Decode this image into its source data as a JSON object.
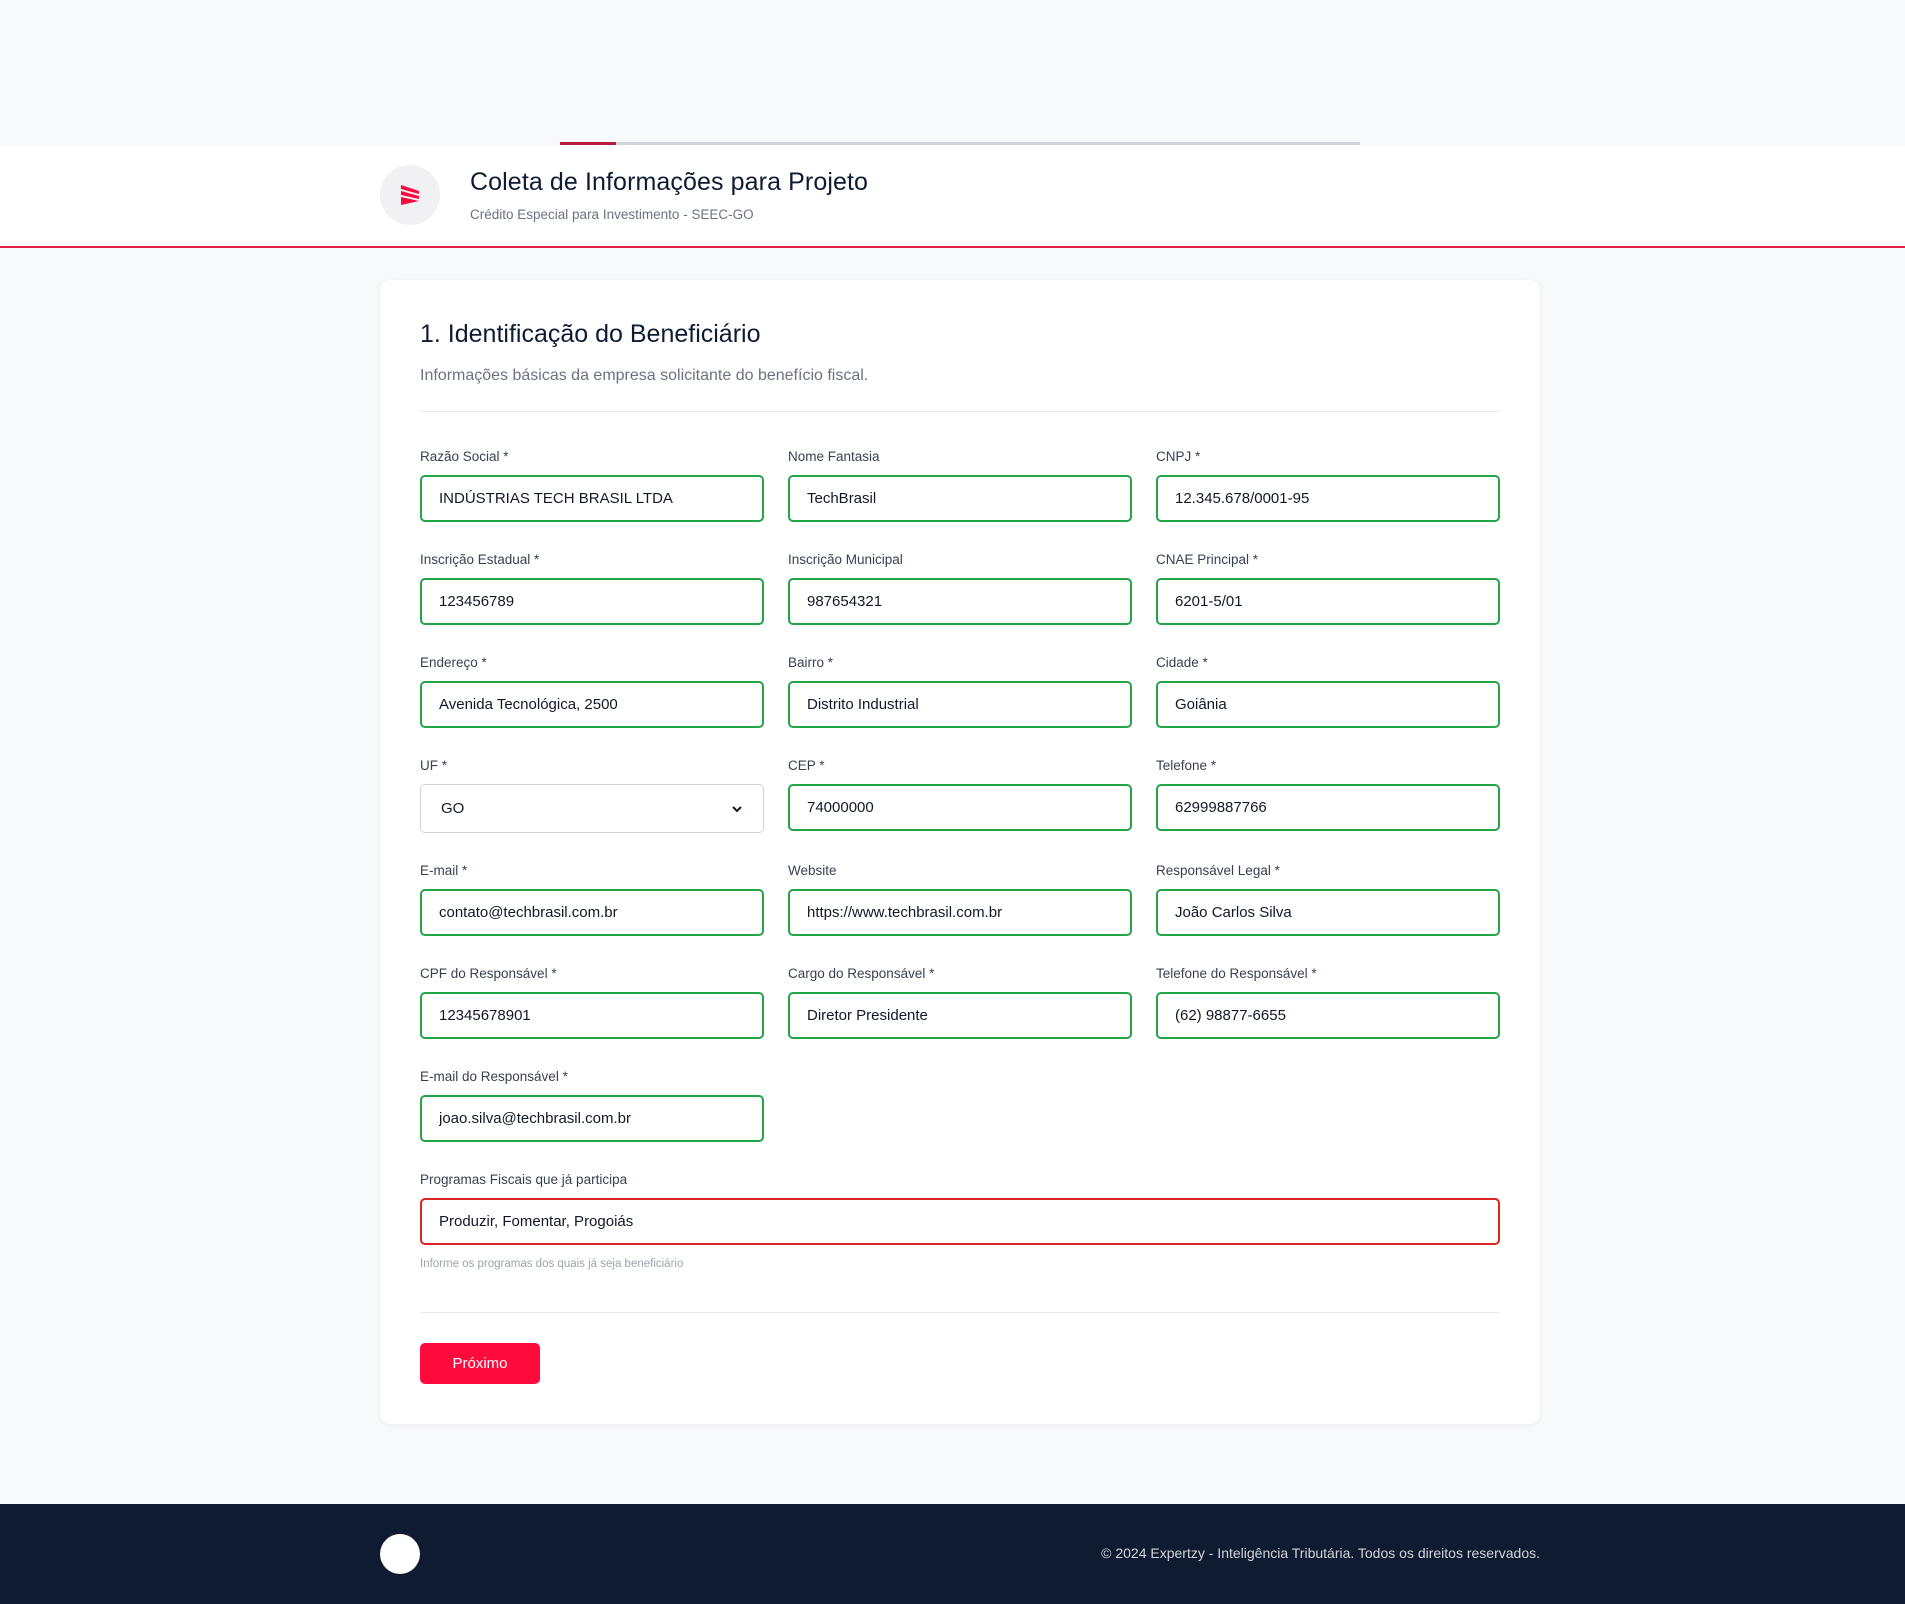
{
  "progress": {
    "percent": 7
  },
  "header": {
    "title": "Coleta de Informações para Projeto",
    "subtitle": "Crédito Especial para Investimento - SEEC-GO"
  },
  "section": {
    "title": "1. Identificação do Beneficiário",
    "description": "Informações básicas da empresa solicitante do benefício fiscal."
  },
  "fields": {
    "razao_social": {
      "label": "Razão Social *",
      "value": "INDÚSTRIAS TECH BRASIL LTDA"
    },
    "nome_fantasia": {
      "label": "Nome Fantasia",
      "value": "TechBrasil"
    },
    "cnpj": {
      "label": "CNPJ *",
      "value": "12.345.678/0001-95"
    },
    "inscricao_estadual": {
      "label": "Inscrição Estadual *",
      "value": "123456789"
    },
    "inscricao_municipal": {
      "label": "Inscrição Municipal",
      "value": "987654321"
    },
    "cnae": {
      "label": "CNAE Principal *",
      "value": "6201-5/01"
    },
    "endereco": {
      "label": "Endereço *",
      "value": "Avenida Tecnológica, 2500"
    },
    "bairro": {
      "label": "Bairro *",
      "value": "Distrito Industrial"
    },
    "cidade": {
      "label": "Cidade *",
      "value": "Goiânia"
    },
    "uf": {
      "label": "UF *",
      "value": "GO"
    },
    "cep": {
      "label": "CEP *",
      "value": "74000000"
    },
    "telefone": {
      "label": "Telefone *",
      "value": "62999887766"
    },
    "email": {
      "label": "E-mail *",
      "value": "contato@techbrasil.com.br"
    },
    "website": {
      "label": "Website",
      "value": "https://www.techbrasil.com.br"
    },
    "responsavel_legal": {
      "label": "Responsável Legal *",
      "value": "João Carlos Silva"
    },
    "cpf_responsavel": {
      "label": "CPF do Responsável *",
      "value": "12345678901"
    },
    "cargo_responsavel": {
      "label": "Cargo do Responsável *",
      "value": "Diretor Presidente"
    },
    "telefone_responsavel": {
      "label": "Telefone do Responsável *",
      "value": "(62) 98877-6655"
    },
    "email_responsavel": {
      "label": "E-mail do Responsável *",
      "value": "joao.silva@techbrasil.com.br"
    },
    "programas_fiscais": {
      "label": "Programas Fiscais que já participa",
      "value": "Produzir, Fomentar, Progoiás",
      "hint": "Informe os programas dos quais já seja beneficiário"
    }
  },
  "actions": {
    "next_label": "Próximo"
  },
  "footer": {
    "copyright": "© 2024 Expertzy - Inteligência Tributária. Todos os direitos reservados."
  },
  "colors": {
    "accent": "#ff0a3c",
    "valid_border": "#22a447",
    "invalid_border": "#dc2626",
    "footer_bg": "#0e1b30"
  }
}
